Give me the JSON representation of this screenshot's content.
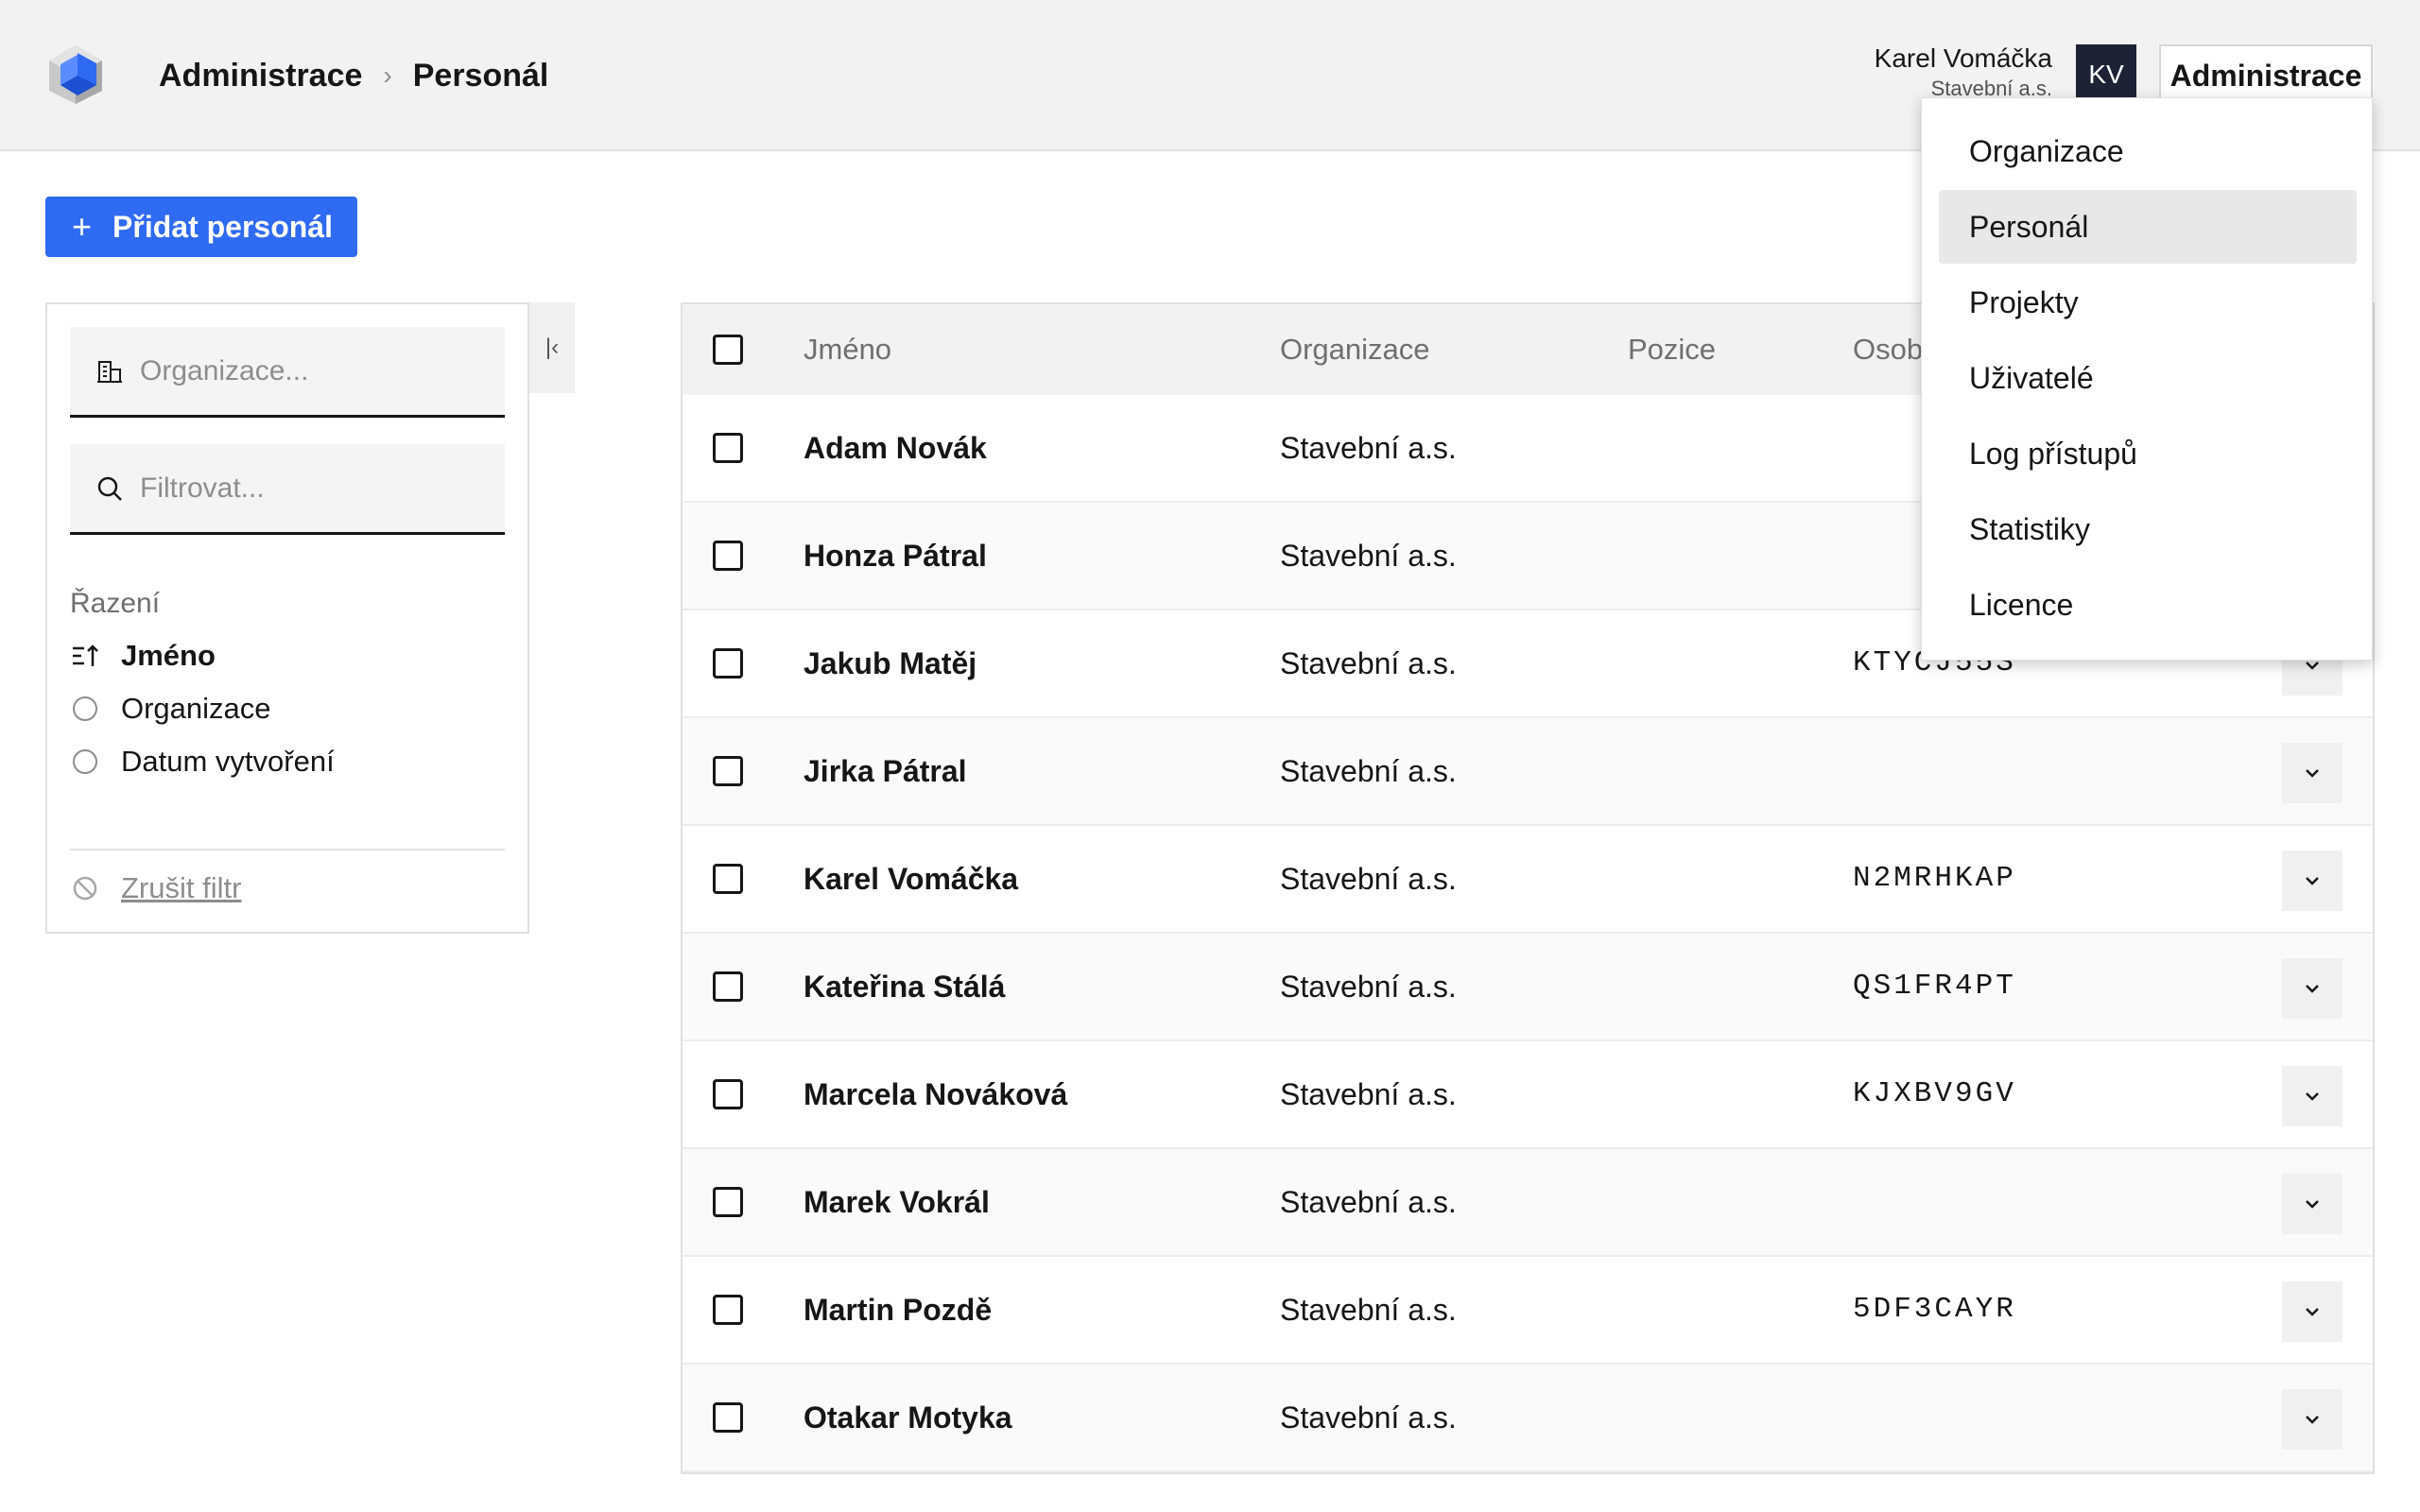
{
  "header": {
    "breadcrumb": [
      "Administrace",
      "Personál"
    ],
    "user_name": "Karel Vomáčka",
    "user_org": "Stavební a.s.",
    "avatar_initials": "KV",
    "admin_label": "Administrace",
    "brand_color": "#2f6af2"
  },
  "toolbar": {
    "add_label": "Přidat personál"
  },
  "filters": {
    "organization_placeholder": "Organizace...",
    "filter_placeholder": "Filtrovat...",
    "sort_heading": "Řazení",
    "sort_options": [
      "Jméno",
      "Organizace",
      "Datum vytvoření"
    ],
    "active_sort": "Jméno",
    "clear_label": "Zrušit filtr"
  },
  "table": {
    "columns": [
      "Jméno",
      "Organizace",
      "Pozice",
      "Osob"
    ],
    "rows": [
      {
        "name": "Adam Novák",
        "org": "Stavební a.s.",
        "position": "",
        "code": ""
      },
      {
        "name": "Honza Pátral",
        "org": "Stavební a.s.",
        "position": "",
        "code": ""
      },
      {
        "name": "Jakub Matěj",
        "org": "Stavební a.s.",
        "position": "",
        "code": "KTYCJ55S"
      },
      {
        "name": "Jirka Pátral",
        "org": "Stavební a.s.",
        "position": "",
        "code": ""
      },
      {
        "name": "Karel Vomáčka",
        "org": "Stavební a.s.",
        "position": "",
        "code": "N2MRHKAP"
      },
      {
        "name": "Kateřina Stálá",
        "org": "Stavební a.s.",
        "position": "",
        "code": "QS1FR4PT"
      },
      {
        "name": "Marcela Nováková",
        "org": "Stavební a.s.",
        "position": "",
        "code": "KJXBV9GV"
      },
      {
        "name": "Marek Vokrál",
        "org": "Stavební a.s.",
        "position": "",
        "code": ""
      },
      {
        "name": "Martin Pozdě",
        "org": "Stavební a.s.",
        "position": "",
        "code": "5DF3CAYR"
      },
      {
        "name": "Otakar Motyka",
        "org": "Stavební a.s.",
        "position": "",
        "code": ""
      }
    ]
  },
  "menu": {
    "items": [
      "Organizace",
      "Personál",
      "Projekty",
      "Uživatelé",
      "Log přístupů",
      "Statistiky",
      "Licence"
    ],
    "selected": "Personál"
  }
}
